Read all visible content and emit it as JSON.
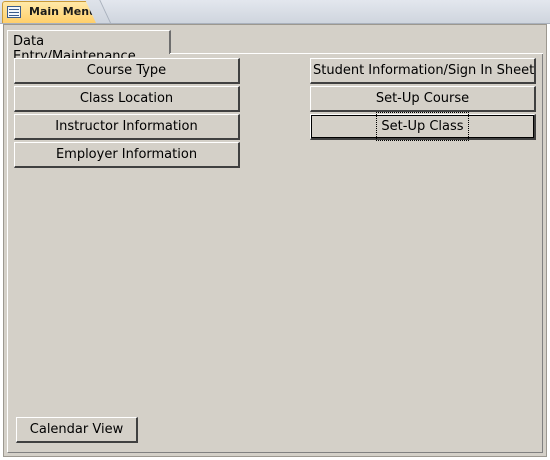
{
  "document_tab": {
    "title": "Main Menu",
    "icon": "form-icon"
  },
  "form": {
    "page_tab": "Data Entry/Maintenance",
    "left_buttons": [
      "Course Type",
      "Class Location",
      "Instructor Information",
      "Employer Information"
    ],
    "right_buttons": [
      "Student Information/Sign In Sheet",
      "Set-Up Course",
      "Set-Up Class"
    ],
    "calendar_button": "Calendar View"
  }
}
